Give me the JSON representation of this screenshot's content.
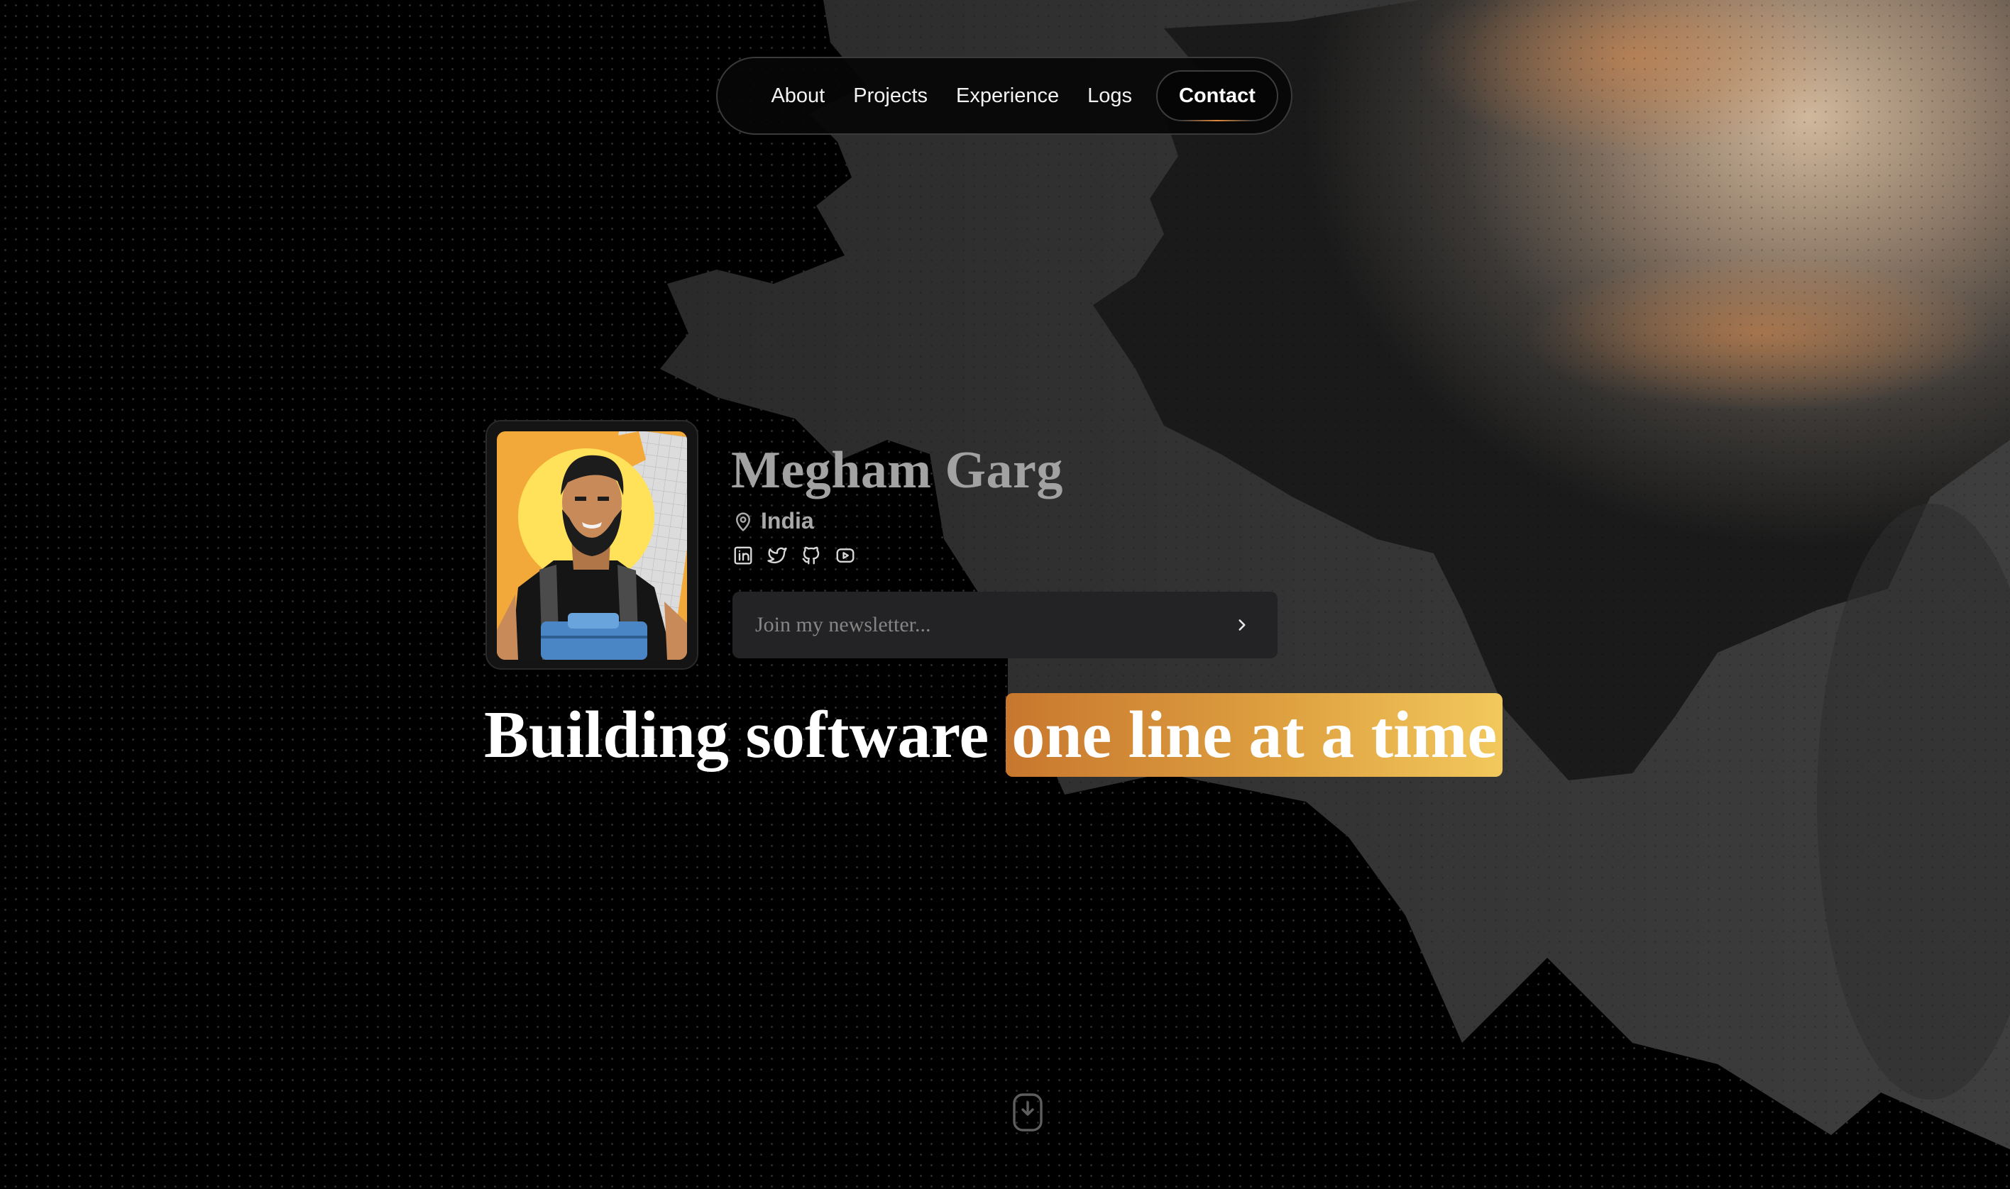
{
  "nav": {
    "items": [
      {
        "label": "About"
      },
      {
        "label": "Projects"
      },
      {
        "label": "Experience"
      },
      {
        "label": "Logs"
      }
    ],
    "contact_label": "Contact"
  },
  "profile": {
    "name": "Megham Garg",
    "location": "India",
    "location_icon": "map-pin-icon",
    "socials": [
      {
        "icon": "linkedin-icon"
      },
      {
        "icon": "twitter-icon"
      },
      {
        "icon": "github-icon"
      },
      {
        "icon": "youtube-icon"
      }
    ]
  },
  "newsletter": {
    "placeholder": "Join my newsletter...",
    "value": "",
    "submit_icon": "chevron-right-icon"
  },
  "hero": {
    "headline_prefix": "Building software",
    "headline_highlight": "one line at a time"
  },
  "scroll_indicator": {
    "icon": "mouse-scroll-down-icon"
  },
  "colors": {
    "background": "#000000",
    "accent_start": "#c8772e",
    "accent_end": "#f2c85c",
    "name_gray": "#a2a2a2"
  }
}
